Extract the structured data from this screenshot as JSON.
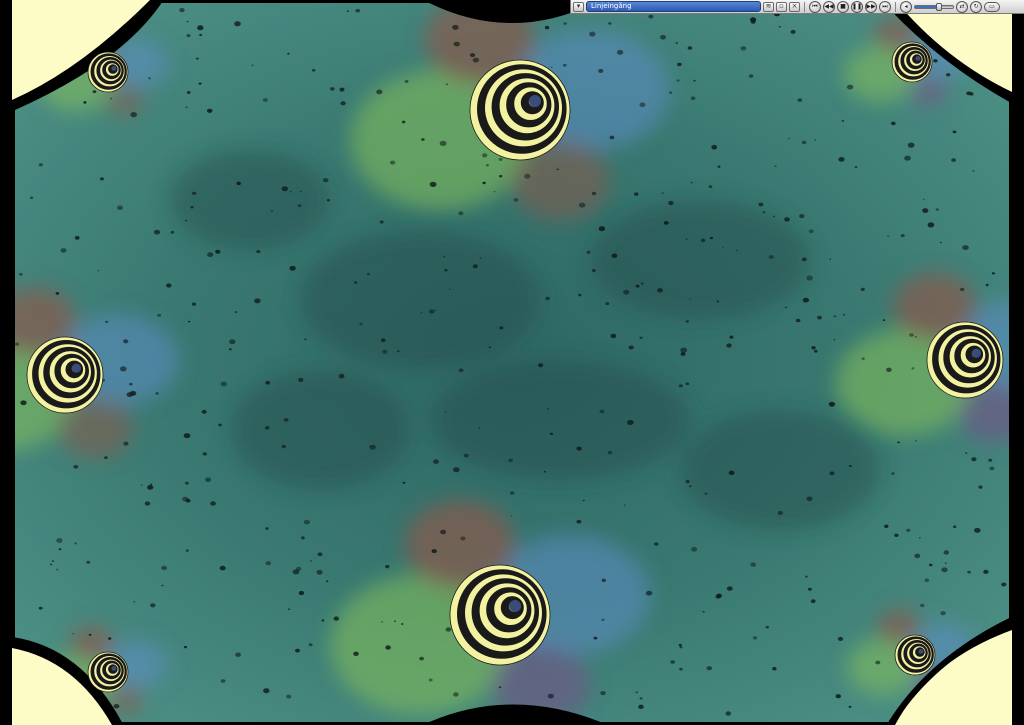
{
  "player": {
    "now_playing": "Linjeingång",
    "icons": {
      "menu": "menu-icon",
      "visualization_toggle": "visualization-icon",
      "close": "close-icon",
      "restore": "restore-icon",
      "previous": "previous-icon",
      "rewind": "rewind-icon",
      "stop": "stop-icon",
      "play": "play-icon",
      "pause": "pause-icon",
      "fast_forward": "fast-forward-icon",
      "next": "next-icon",
      "mute": "speaker-icon",
      "shuffle": "shuffle-icon",
      "repeat": "repeat-icon",
      "return_full_mode": "return-full-mode-icon"
    },
    "glyphs": {
      "menu": "▾",
      "visualization_toggle": "≋",
      "close": "×",
      "restore": "▫",
      "previous": "⏮",
      "rewind": "◀◀",
      "stop": "■",
      "play": "▶",
      "pause": "❚❚",
      "fast_forward": "▶▶",
      "next": "⏭",
      "mute": "◂",
      "shuffle": "⇄",
      "repeat": "↻",
      "return_full_mode": "▭"
    },
    "volume_level": 0.6
  },
  "colors": {
    "background": "#2f6a68",
    "border": "#000000",
    "corner_fill": "#fdfbc6",
    "spiral_light": "#f3f2a1",
    "spiral_dark": "#1a1a1a",
    "lobe_green": "#86c35a",
    "lobe_blue": "#5f8fcf",
    "lobe_brown": "#8a5a4c",
    "lobe_purple": "#7a4f8a"
  }
}
